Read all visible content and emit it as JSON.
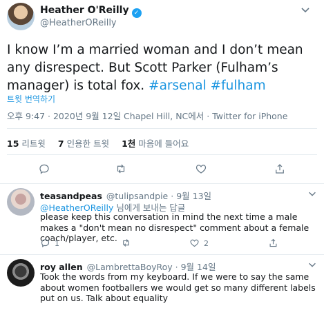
{
  "main_tweet": {
    "display_name": "Heather O'Reilly",
    "handle": "@HeatherOReilly",
    "text_before": "I know I’m a married woman and I don’t mean any disrespect. But Scott Parker (Fulham’s manager) is total fox. ",
    "hashtag_1": "#arsenal",
    "hashtag_2": "#fulham",
    "translate_label": "트윗 번역하기",
    "meta": "오후 9:47 · 2020년 9월 12일 Chapel Hill, NC에서 · Twitter for iPhone",
    "stats": {
      "retweets_count": "15",
      "retweets_label": "리트윗",
      "quotes_count": "7",
      "quotes_label": "인용한 트윗",
      "likes_count": "1천",
      "likes_label": "마음에 들어요"
    }
  },
  "replies": [
    {
      "display_name": "teasandpeas",
      "handle": "@tulipsandpie",
      "date": "9월 13일",
      "reply_to_mention": "@HeatherOReilly",
      "reply_to_suffix": " 님에게 보내는 답글",
      "text": "please keep this conversation in mind the next time a male makes a \"don't mean no disrespect\" comment about a female coach/player, etc.",
      "reply_count": "1",
      "retweet_count": "",
      "like_count": "2"
    },
    {
      "display_name": "roy allen",
      "handle": "@LambrettaBoyRoy",
      "date": "9월 14일",
      "text": "Took the words from my keyboard. If we were to say the same about women footballers we would get so many different labels put on us. Talk about equality"
    }
  ],
  "colors": {
    "link": "#1b95e0",
    "verified": "#1da1f2",
    "muted": "#657786",
    "divider": "#e6ecf0"
  },
  "icons": [
    "verified-badge-icon",
    "chevron-down-icon",
    "reply-icon",
    "retweet-icon",
    "like-icon",
    "share-icon"
  ]
}
